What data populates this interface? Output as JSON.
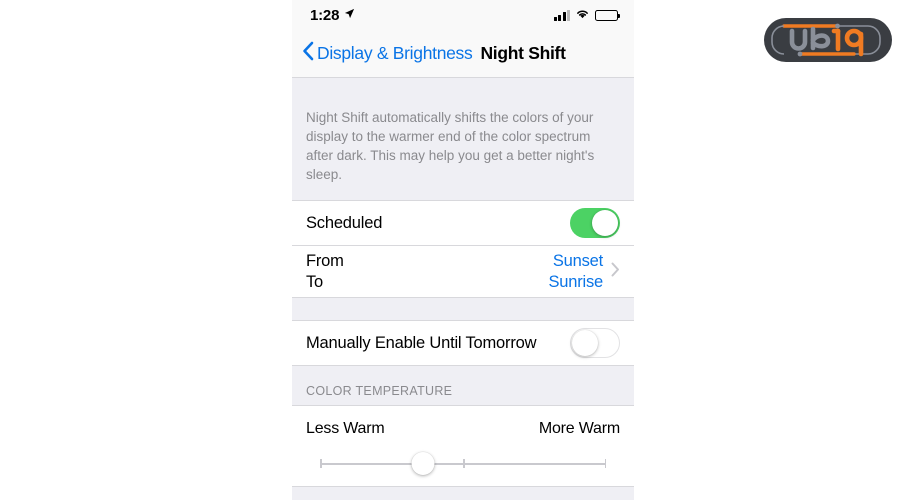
{
  "statusbar": {
    "time": "1:28",
    "location_icon": "location-arrow-icon",
    "signal_icon": "cellular-signal-icon",
    "wifi_icon": "wifi-icon",
    "battery_icon": "battery-icon"
  },
  "navbar": {
    "back_label": "Display & Brightness",
    "back_icon": "chevron-left-icon",
    "title": "Night Shift"
  },
  "description": "Night Shift automatically shifts the colors of your display to the warmer end of the color spectrum after dark. This may help you get a better night's sleep.",
  "schedule": {
    "scheduled_label": "Scheduled",
    "scheduled_state": "on",
    "from_label": "From",
    "from_value": "Sunset",
    "to_label": "To",
    "to_value": "Sunrise",
    "disclosure_icon": "chevron-right-icon"
  },
  "manual": {
    "label": "Manually Enable Until Tomorrow",
    "state": "off"
  },
  "color_temperature": {
    "section_header": "COLOR TEMPERATURE",
    "min_label": "Less Warm",
    "max_label": "More Warm",
    "value_percent": 36
  },
  "watermark": {
    "text_primary": "UB",
    "text_secondary": "19"
  },
  "colors": {
    "accent_blue": "#0A74E6",
    "toggle_green": "#4CD264",
    "group_bg": "#EFEFF4",
    "separator": "#D8D8DC",
    "secondary_text": "#8A8A8E",
    "logo_dark": "#3A3D42",
    "logo_orange": "#F07B22",
    "logo_gray": "#8A8F99"
  }
}
